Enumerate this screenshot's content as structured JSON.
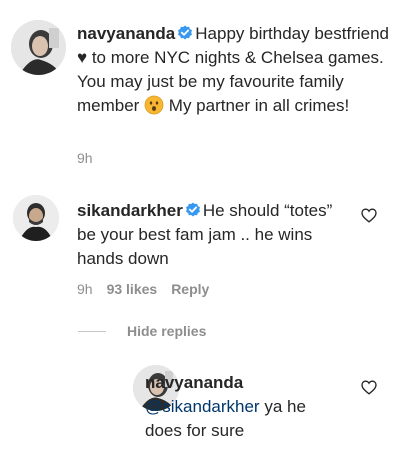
{
  "comments": [
    {
      "username": "navyananda",
      "text": "Happy birthday bestfriend ♥︎ to more NYC nights & Chelsea games. You may just be my favourite family member ",
      "text_after_emoji": " My partner in all crimes!",
      "emoji": "hushed-face-emoji",
      "time": "9h"
    },
    {
      "username": "sikandarkher",
      "text": "He should “totes” be your best fam jam .. he wins hands down",
      "time": "9h",
      "likes": "93 likes",
      "reply_label": "Reply"
    }
  ],
  "hide_replies_label": "Hide replies",
  "reply": {
    "username": "navyananda",
    "mention": "@sikandarkher",
    "text": " ya he does for sure"
  },
  "colors": {
    "verified": "#3897f0",
    "muted": "#8e8e8e",
    "mention": "#00376b",
    "emoji": "#f7b733"
  },
  "icons": [
    "verified-badge-icon",
    "heart-icon"
  ]
}
